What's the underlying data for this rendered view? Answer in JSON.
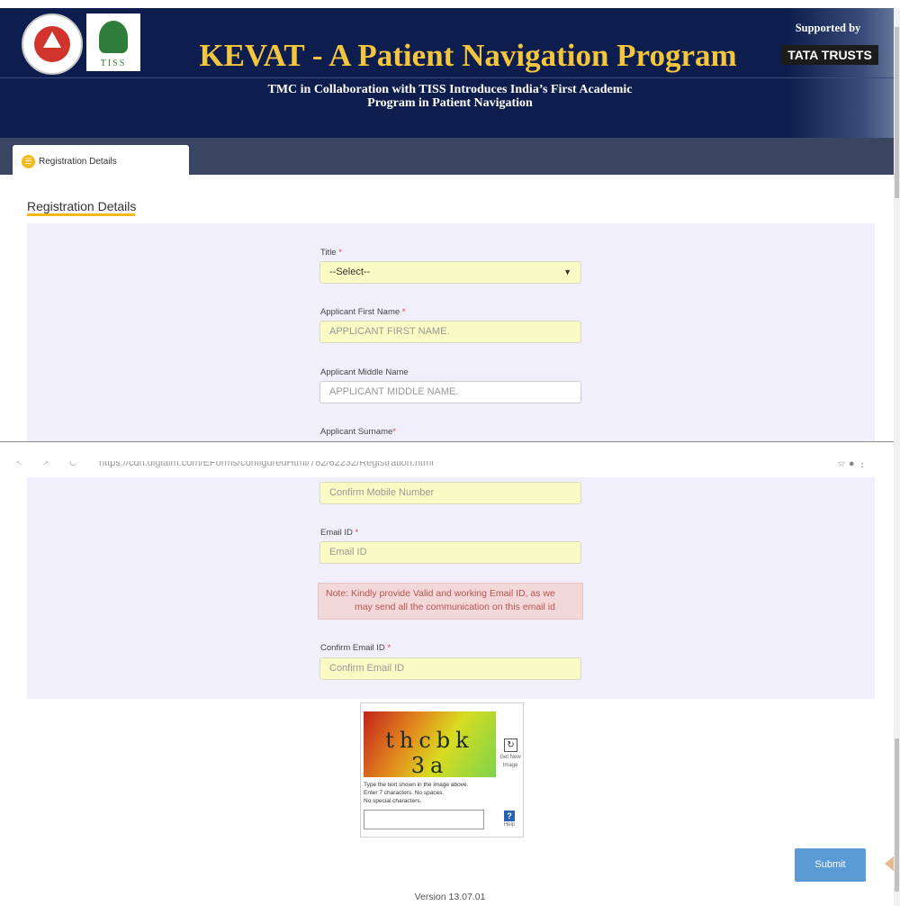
{
  "header": {
    "title": "KEVAT - A Patient Navigation Program",
    "subtitle_line1": "TMC in Collaboration with TISS Introduces India’s First Academic",
    "subtitle_line2": "Program in Patient Navigation",
    "supported_by": "Supported by",
    "sponsor": "TATA TRUSTS",
    "tiss_logo_text": "TISS"
  },
  "tab": {
    "label": "Registration Details",
    "icon": "form-icon"
  },
  "section": {
    "title": "Registration Details"
  },
  "browser": {
    "url": "https://cdn.digialm.com/EForms/configuredHtml/782/62232/Registration.html",
    "nav": "< > C"
  },
  "form": {
    "title_label": "Title",
    "title_value": "--Select--",
    "first_name_label": "Applicant First Name",
    "first_name_placeholder": "APPLICANT FIRST NAME.",
    "middle_name_label": "Applicant Middle Name",
    "middle_name_placeholder": "APPLICANT MIDDLE NAME.",
    "surname_label": "Applicant Surname",
    "confirm_mobile_placeholder": "Confirm Mobile Number",
    "email_label": "Email ID",
    "email_placeholder": "Email ID",
    "note_line1": "Note: Kindly provide Valid and working Email ID, as we",
    "note_line2": "may send all the communication on this email id",
    "confirm_email_label": "Confirm Email ID",
    "confirm_email_placeholder": "Confirm Email ID",
    "required_marker": "*"
  },
  "captcha": {
    "image_text": "thcbk 3a",
    "get_new_label": "Get New Image",
    "instructions_line1": "Type the text shown in the image above.",
    "instructions_line2": "Enter 7 characters. No spaces.",
    "instructions_line3": "No special characters.",
    "help_label": "Help"
  },
  "footer": {
    "submit_label": "Submit",
    "version": "Version 13.07.01"
  },
  "colors": {
    "banner": "#0d1d4d",
    "title_gold": "#f3c63d",
    "accent": "#f5b91a",
    "panel": "#f2effc",
    "field": "#fafac4",
    "submit": "#5b9bd5"
  }
}
